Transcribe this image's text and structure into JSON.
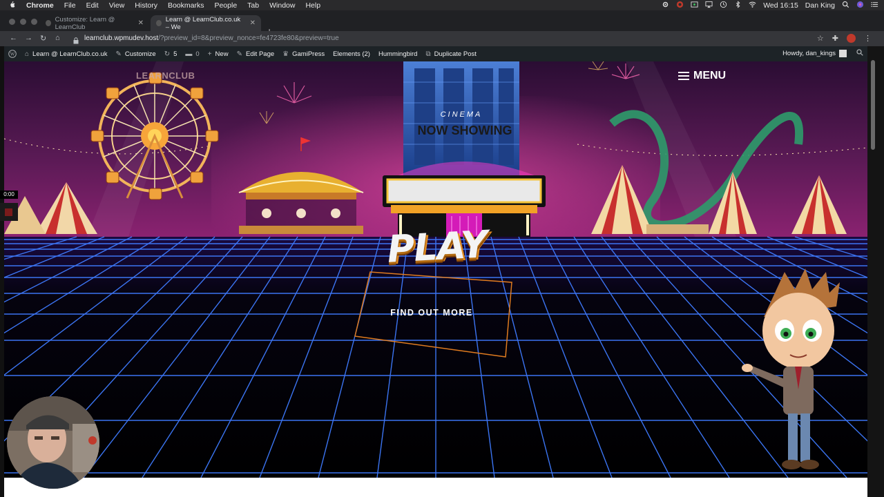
{
  "menubar": {
    "apple": "",
    "app_name": "Chrome",
    "items": [
      "File",
      "Edit",
      "View",
      "History",
      "Bookmarks",
      "People",
      "Tab",
      "Window",
      "Help"
    ],
    "clock": "Wed 16:15",
    "user": "Dan King"
  },
  "tabs": [
    {
      "title": "Customize: Learn @ LearnClub",
      "active": false
    },
    {
      "title": "Learn @ LearnClub.co.uk – We",
      "active": true
    }
  ],
  "address": {
    "host": "learnclub.wpmudev.host",
    "path": "/?preview_id=8&preview_nonce=fe4723fe80&preview=true"
  },
  "wpbar": {
    "site": "Learn @ LearnClub.co.uk",
    "customize": "Customize",
    "updates": "5",
    "comments": "0",
    "new": "New",
    "edit_page": "Edit Page",
    "gamipress": "GamiPress",
    "elements": "Elements (2)",
    "hummingbird": "Hummingbird",
    "duplicate": "Duplicate Post",
    "howdy": "Howdy, dan_kings"
  },
  "site": {
    "logo": "LEARNCLUB",
    "menu_label": "MENU",
    "cinema": "CINEMA",
    "now_showing": "NOW SHOWING",
    "play": "PLAY",
    "find_more": "FIND OUT MORE"
  },
  "recorder": {
    "timer": "0:00"
  },
  "colors": {
    "sky_top": "#2a0d33",
    "sky_mid": "#7a1f6a",
    "grid": "#3f7bff",
    "accent_orange": "#e07b1f",
    "wp_bar": "#1d2327"
  }
}
